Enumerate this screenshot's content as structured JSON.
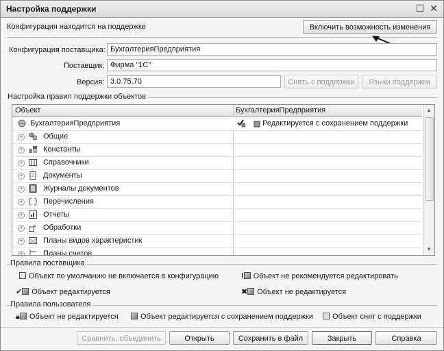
{
  "window": {
    "title": "Настройка поддержки",
    "restore_glyph": "☐",
    "close_glyph": "✕"
  },
  "status_text": "Конфигурация находится на поддержке",
  "enable_button": "Включить возможность изменения",
  "vendor_config_label": "Конфигурация поставщика:",
  "vendor_config_value": "БухгалтерияПредприятия",
  "vendor_label": "Поставщик:",
  "vendor_value": "Фирма \"1С\"",
  "version_label": "Версия:",
  "version_value": "3.0.75.70",
  "remove_support_button": "Снять с поддержки",
  "support_languages_button": "Языки поддержки",
  "rules_group_title": "Настройка правил поддержки объектов",
  "table": {
    "headers": [
      "Объект",
      "БухгалтерияПредприятия"
    ],
    "root": {
      "name": "БухгалтерияПредприятия",
      "rule": "Редактируется с сохранением поддержки"
    },
    "rows": [
      {
        "name": "Общие",
        "icon": "common-icon"
      },
      {
        "name": "Константы",
        "icon": "constants-icon"
      },
      {
        "name": "Справочники",
        "icon": "catalogs-icon"
      },
      {
        "name": "Документы",
        "icon": "documents-icon"
      },
      {
        "name": "Журналы документов",
        "icon": "journals-icon"
      },
      {
        "name": "Перечисления",
        "icon": "enums-icon"
      },
      {
        "name": "Отчеты",
        "icon": "reports-icon"
      },
      {
        "name": "Обработки",
        "icon": "processors-icon"
      },
      {
        "name": "Планы видов характеристик",
        "icon": "chart-types-icon"
      },
      {
        "name": "Планы счетов",
        "icon": "accounts-icon"
      }
    ]
  },
  "vendor_rules": {
    "title": "Правила поставщика",
    "items": [
      "Объект по умолчанию не включается в конфигурацию",
      "Объект не рекомендуется редактировать",
      "Объект редактируется",
      "Объект не редактируется"
    ]
  },
  "user_rules": {
    "title": "Правила пользователя",
    "items": [
      "Объект не редактируется",
      "Объект редактируется с сохранением поддержки",
      "Объект снят с поддержки"
    ]
  },
  "footer": {
    "compare_button": "Сравнить, объединить",
    "open_button": "Открыть",
    "save_button": "Сохранить в файл",
    "close_button": "Закрыть",
    "help_button": "Справка"
  }
}
